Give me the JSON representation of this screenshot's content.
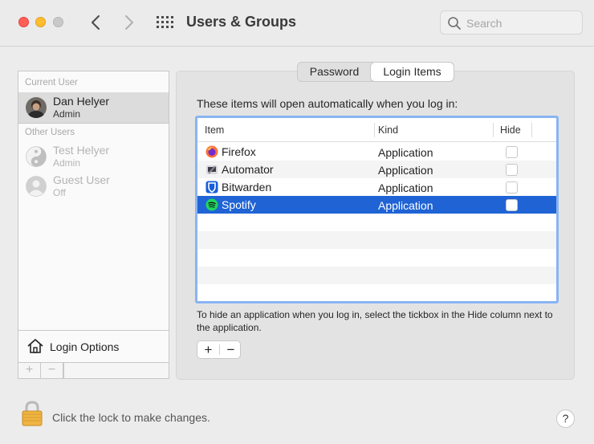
{
  "window": {
    "title": "Users & Groups"
  },
  "search": {
    "placeholder": "Search"
  },
  "sidebar": {
    "current_user_label": "Current User",
    "current_user": {
      "name": "Dan Helyer",
      "role": "Admin"
    },
    "other_users_label": "Other Users",
    "other_users": [
      {
        "name": "Test Helyer",
        "role": "Admin"
      },
      {
        "name": "Guest User",
        "role": "Off"
      }
    ],
    "login_options": "Login Options",
    "add_label": "+",
    "remove_label": "−"
  },
  "tabs": [
    {
      "label": "Password",
      "selected": false
    },
    {
      "label": "Login Items",
      "selected": true
    }
  ],
  "login_items": {
    "intro": "These items will open automatically when you log in:",
    "columns": {
      "item": "Item",
      "kind": "Kind",
      "hide": "Hide"
    },
    "rows": [
      {
        "name": "Firefox",
        "kind": "Application",
        "hide": false,
        "icon": "firefox-icon"
      },
      {
        "name": "Automator",
        "kind": "Application",
        "hide": false,
        "icon": "automator-icon"
      },
      {
        "name": "Bitwarden",
        "kind": "Application",
        "hide": false,
        "icon": "bitwarden-icon"
      },
      {
        "name": "Spotify",
        "kind": "Application",
        "hide": false,
        "icon": "spotify-icon",
        "selected": true
      }
    ],
    "help_text": "To hide an application when you log in, select the tickbox in the Hide column next to the application.",
    "add_label": "+",
    "remove_label": "−"
  },
  "footer": {
    "lock_text": "Click the lock to make changes.",
    "help_label": "?"
  },
  "colors": {
    "selection": "#1f63d5",
    "focus_ring": "#89b4f3"
  }
}
